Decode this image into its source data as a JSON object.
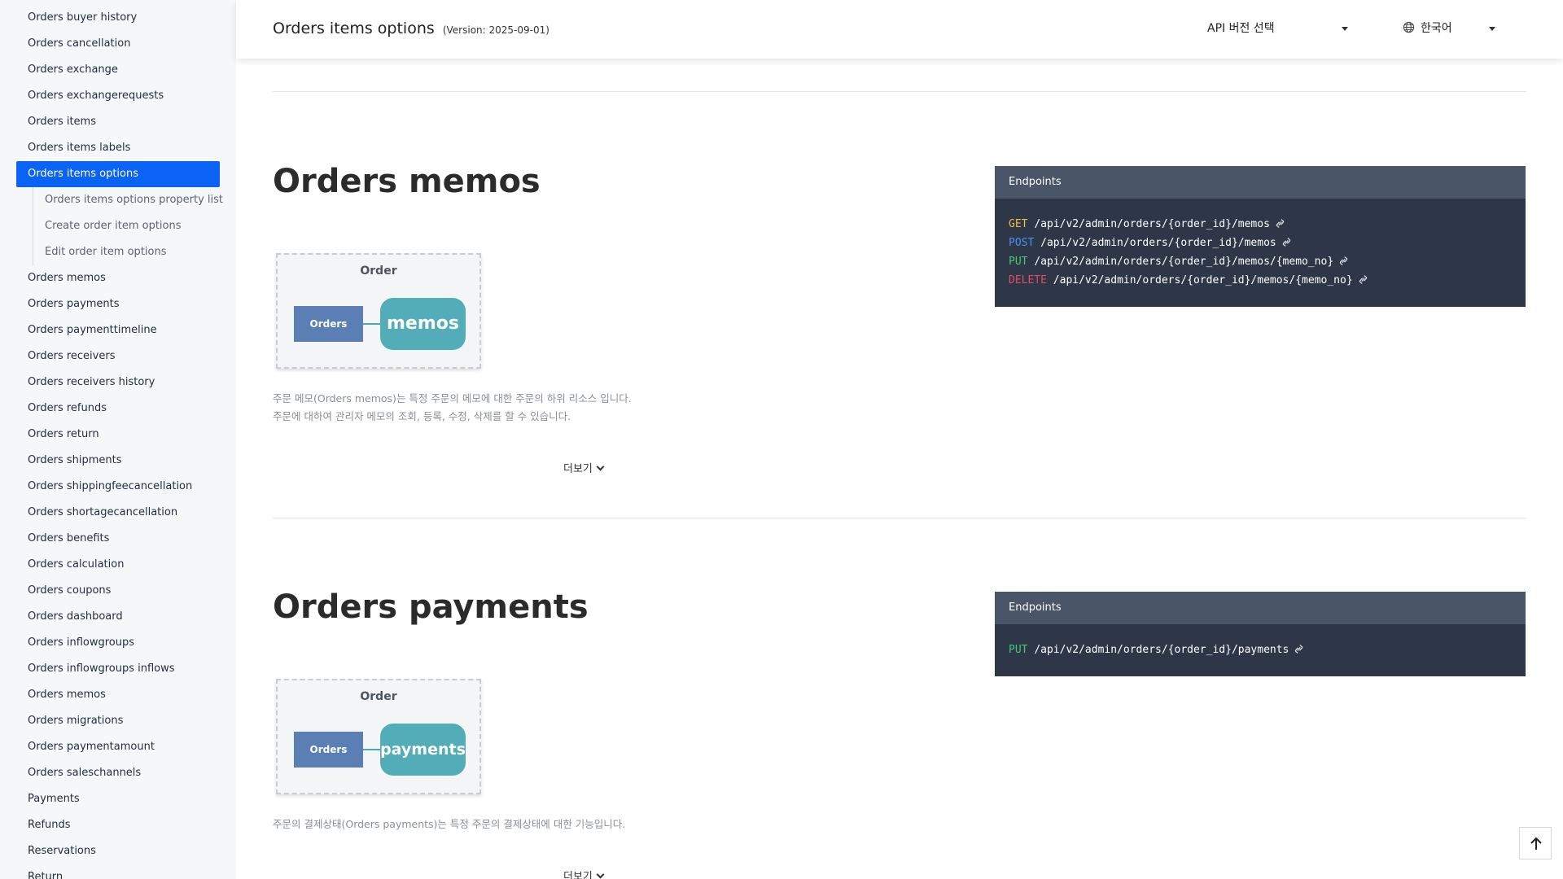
{
  "sidebar": {
    "items_before": [
      {
        "label": "Orders buyer history"
      },
      {
        "label": "Orders cancellation"
      },
      {
        "label": "Orders exchange"
      },
      {
        "label": "Orders exchangerequests"
      },
      {
        "label": "Orders items"
      },
      {
        "label": "Orders items labels"
      }
    ],
    "active_item": {
      "label": "Orders items options"
    },
    "sub_items": [
      {
        "label": "Orders items options property list"
      },
      {
        "label": "Create order item options"
      },
      {
        "label": "Edit order item options"
      }
    ],
    "items_after": [
      {
        "label": "Orders memos"
      },
      {
        "label": "Orders payments"
      },
      {
        "label": "Orders paymenttimeline"
      },
      {
        "label": "Orders receivers"
      },
      {
        "label": "Orders receivers history"
      },
      {
        "label": "Orders refunds"
      },
      {
        "label": "Orders return"
      },
      {
        "label": "Orders shipments"
      },
      {
        "label": "Orders shippingfeecancellation"
      },
      {
        "label": "Orders shortagecancellation"
      },
      {
        "label": "Orders benefits"
      },
      {
        "label": "Orders calculation"
      },
      {
        "label": "Orders coupons"
      },
      {
        "label": "Orders dashboard"
      },
      {
        "label": "Orders inflowgroups"
      },
      {
        "label": "Orders inflowgroups inflows"
      },
      {
        "label": "Orders memos"
      },
      {
        "label": "Orders migrations"
      },
      {
        "label": "Orders paymentamount"
      },
      {
        "label": "Orders saleschannels"
      },
      {
        "label": "Payments"
      },
      {
        "label": "Refunds"
      },
      {
        "label": "Reservations"
      },
      {
        "label": "Return"
      }
    ]
  },
  "header": {
    "title": "Orders items options",
    "version": "(Version: 2025-09-01)",
    "api_select_label": "API 버전 선택",
    "language_label": "한국어"
  },
  "sections": [
    {
      "title": "Orders memos",
      "diagram": {
        "parent": "Order",
        "node": "Orders",
        "sub": "memos"
      },
      "desc_lines": [
        "주문 메모(Orders memos)는 특정 주문의 메모에 대한 주문의 하위 리소스 입니다.",
        "주문에 대하여 관리자 메모의 조회, 등록, 수정, 삭제를 할 수 있습니다."
      ],
      "more_label": "더보기",
      "endpoints_title": "Endpoints",
      "endpoints": [
        {
          "method": "GET",
          "path": "/api/v2/admin/orders/{order_id}/memos"
        },
        {
          "method": "POST",
          "path": "/api/v2/admin/orders/{order_id}/memos"
        },
        {
          "method": "PUT",
          "path": "/api/v2/admin/orders/{order_id}/memos/{memo_no}"
        },
        {
          "method": "DELETE",
          "path": "/api/v2/admin/orders/{order_id}/memos/{memo_no}"
        }
      ]
    },
    {
      "title": "Orders payments",
      "diagram": {
        "parent": "Order",
        "node": "Orders",
        "sub": "payments"
      },
      "desc_lines": [
        "주문의 결제상태(Orders payments)는 특정 주문의 결제상태에 대한 기능입니다."
      ],
      "more_label": "더보기",
      "endpoints_title": "Endpoints",
      "endpoints": [
        {
          "method": "PUT",
          "path": "/api/v2/admin/orders/{order_id}/payments"
        }
      ]
    }
  ],
  "colors": {
    "accent": "#0b63f6",
    "endpoint_panel": "#2d3748",
    "endpoint_header": "#4a5568",
    "diagram_node": "#5b7fb5",
    "diagram_sub": "#52adb9",
    "method_get": "#f6b93b",
    "method_post": "#4f8df9",
    "method_put": "#48c774",
    "method_delete": "#e8496a"
  },
  "icons": {
    "globe": "globe-icon",
    "caret": "caret-down-icon",
    "link": "link-icon",
    "scroll_top": "arrow-up-icon",
    "expand": "chevron-down-icon"
  }
}
